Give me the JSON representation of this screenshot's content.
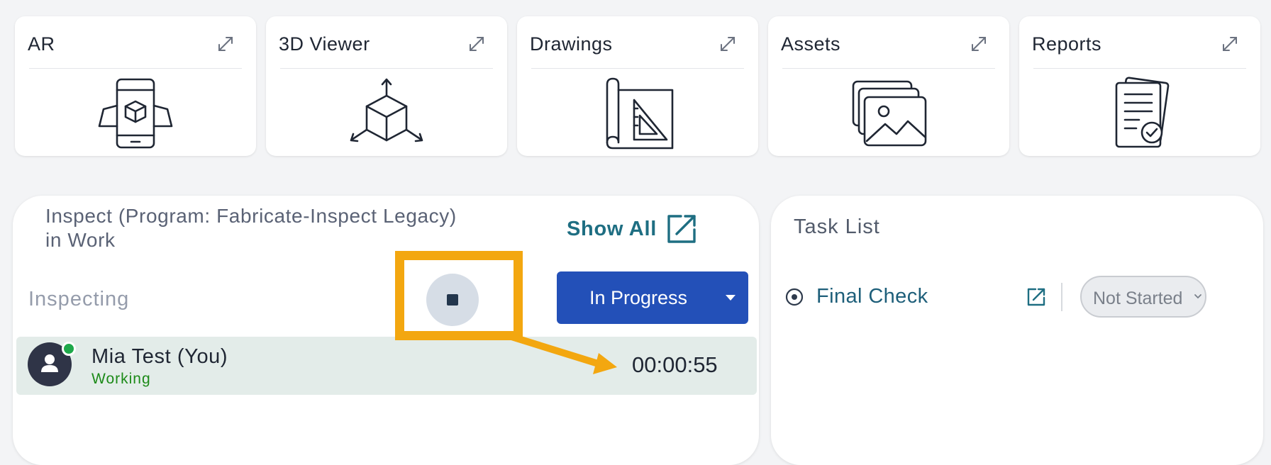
{
  "cards": [
    {
      "title": "AR",
      "icon": "ar-phone-cube-icon",
      "expand_icon": "expand-icon"
    },
    {
      "title": "3D Viewer",
      "icon": "cube-axes-icon",
      "expand_icon": "expand-icon"
    },
    {
      "title": "Drawings",
      "icon": "blueprint-drawing-icon",
      "expand_icon": "expand-icon"
    },
    {
      "title": "Assets",
      "icon": "image-stack-icon",
      "expand_icon": "expand-icon"
    },
    {
      "title": "Reports",
      "icon": "report-check-icon",
      "expand_icon": "expand-icon"
    }
  ],
  "inspect_panel": {
    "title_line1": "Inspect (Program: Fabricate-Inspect Legacy)",
    "title_line2": "in Work",
    "show_all_label": "Show All",
    "show_all_icon": "external-link-icon",
    "section_label": "Inspecting",
    "stop_icon": "stop-icon",
    "status_button_label": "In Progress",
    "status_caret_icon": "caret-down-icon",
    "worker": {
      "name": "Mia Test (You)",
      "status": "Working",
      "timer": "00:00:55",
      "avatar_icon": "user-icon"
    }
  },
  "task_panel": {
    "title": "Task List",
    "tasks": [
      {
        "name": "Final Check",
        "icon": "radio-target-icon",
        "open_icon": "external-link-icon",
        "status": "Not Started",
        "status_caret_icon": "chevron-down-icon"
      }
    ]
  },
  "annotation": {
    "highlight_color": "#f3a710",
    "arrow_color": "#f3a710"
  },
  "colors": {
    "primary_button": "#2350b8",
    "worker_row_bg": "#e3ece9",
    "working_status": "#1c8a18",
    "link": "#1e6e82"
  }
}
